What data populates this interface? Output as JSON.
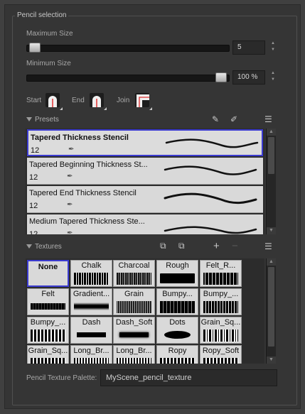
{
  "group_title": "Pencil selection",
  "max_size": {
    "label": "Maximum Size",
    "value": "5",
    "level": 0.04
  },
  "min_size": {
    "label": "Minimum Size",
    "value": "100 %",
    "level": 1.0
  },
  "tips": {
    "start": "Start",
    "end": "End",
    "join": "Join"
  },
  "presets": {
    "header": "Presets",
    "items": [
      {
        "name": "Tapered Thickness Stencil",
        "size": "12",
        "selected": true
      },
      {
        "name": "Tapered Beginning Thickness St...",
        "size": "12",
        "selected": false
      },
      {
        "name": "Tapered End Thickness Stencil",
        "size": "12",
        "selected": false
      },
      {
        "name": "Medium Tapered Thickness Ste...",
        "size": "12",
        "selected": false
      }
    ]
  },
  "textures": {
    "header": "Textures",
    "items": [
      "None",
      "Chalk",
      "Charcoal",
      "Rough",
      "Felt_R...",
      "Felt",
      "Gradient...",
      "Grain",
      "Bumpy...",
      "Bumpy_...",
      "Bumpy_...",
      "Dash",
      "Dash_Soft",
      "Dots",
      "Grain_Sq...",
      "Grain_Sq...",
      "Long_Br...",
      "Long_Br...",
      "Ropy",
      "Ropy_Soft"
    ]
  },
  "palette": {
    "label": "Pencil Texture Palette:",
    "value": "MyScene_pencil_texture"
  },
  "icons": {
    "add_preset": "add-preset-icon",
    "rename_preset": "rename-preset-icon",
    "menu": "hamburger-menu-icon",
    "import_texture": "import-texture-icon",
    "export_texture": "export-texture-icon",
    "add": "plus-icon",
    "remove": "minus-icon"
  },
  "colors": {
    "selection": "#3b3bd0",
    "tip_accent": "#e03030"
  }
}
